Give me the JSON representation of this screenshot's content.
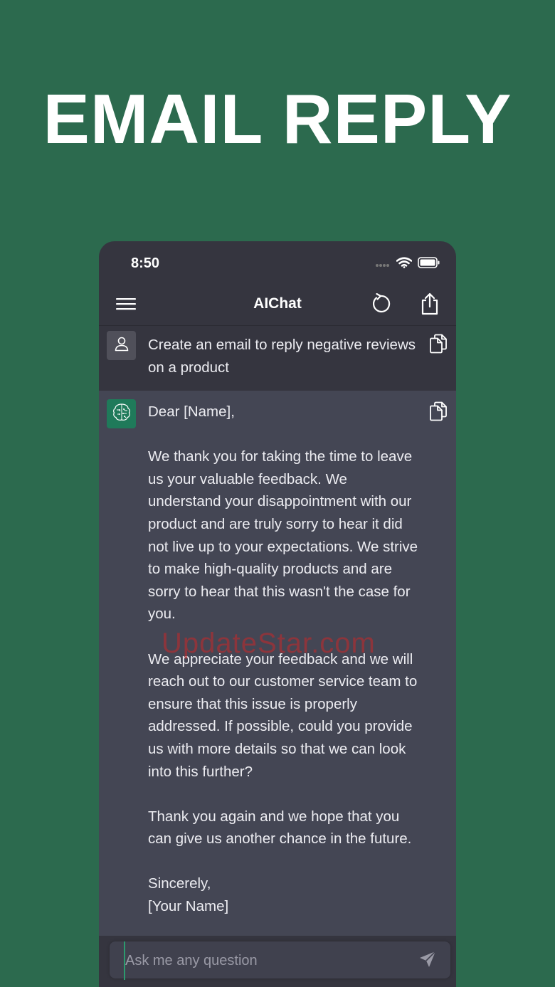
{
  "headline": "EMAIL REPLY",
  "status_bar": {
    "time": "8:50"
  },
  "nav": {
    "title": "AIChat"
  },
  "messages": [
    {
      "role": "user",
      "text": "Create an email to reply negative reviews on a product"
    },
    {
      "role": "assistant",
      "text": "Dear [Name],\n\nWe thank you for taking the time to leave us your valuable feedback. We understand your disappointment with our product and are truly sorry to hear it did not live up to your expectations. We strive to make high-quality products and are sorry to hear that this wasn't the case for you.\n\nWe appreciate your feedback and we will reach out to our customer service team to ensure that this issue is properly addressed. If possible, could you provide us with more details so that we can look into this further?\n\nThank you again and we hope that you can give us another chance in the future.\n\nSincerely,\n[Your Name]"
    }
  ],
  "watermark": "UpdateStar.com",
  "input": {
    "placeholder": "Ask me any question",
    "value": ""
  },
  "colors": {
    "background": "#2c6a4e",
    "app_bg": "#35353f",
    "assistant_bg": "#444654",
    "accent": "#1f7a5a"
  }
}
